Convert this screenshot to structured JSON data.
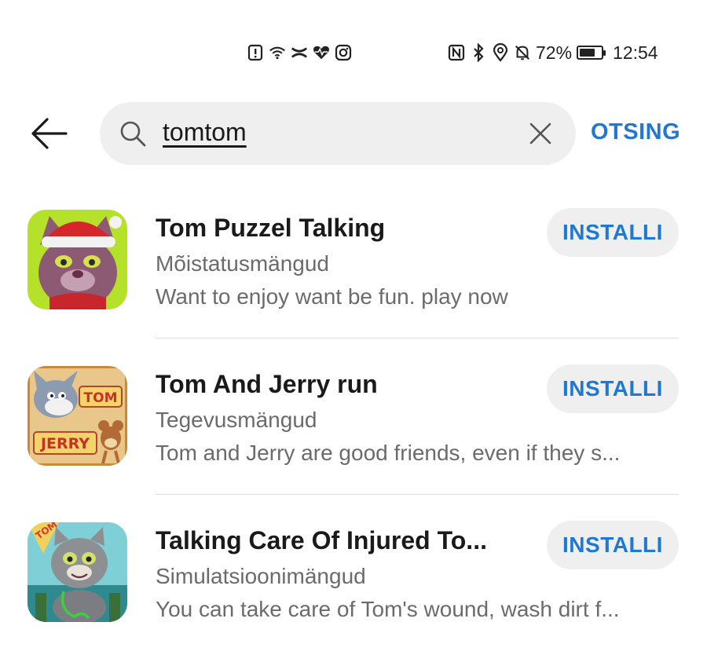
{
  "status_bar": {
    "battery_percent": "72%",
    "battery_level": 0.72,
    "time": "12:54",
    "left_icons": [
      "alert-icon",
      "wifi-icon",
      "ua-logo-icon",
      "heart-rate-icon",
      "instagram-icon"
    ],
    "right_icons": [
      "nfc-icon",
      "bluetooth-icon",
      "location-icon",
      "bell-off-icon",
      "battery-icon"
    ]
  },
  "search": {
    "query": "tomtom",
    "submit_label": "OTSING"
  },
  "results": [
    {
      "title": "Tom Puzzel Talking",
      "category": "Mõistatusmängud",
      "description": "Want to enjoy want be fun. play now",
      "button": "INSTALLI"
    },
    {
      "title": "Tom And Jerry run",
      "category": "Tegevusmängud",
      "description": "Tom and Jerry are good friends, even if they s...",
      "button": "INSTALLI"
    },
    {
      "title": "Talking Care Of Injured To...",
      "category": "Simulatsioonimängud",
      "description": "You can take care of Tom's wound, wash dirt f...",
      "button": "INSTALLI"
    }
  ],
  "icon_images": {
    "result_0": {
      "lettering": []
    },
    "result_1": {
      "lettering": [
        "TOM",
        "JERRY"
      ]
    },
    "result_2": {
      "lettering": [
        "TOM"
      ]
    }
  },
  "colors": {
    "accent": "#1f78d1",
    "search_bg": "#efefef",
    "secondary_text": "#6b6b6b"
  }
}
